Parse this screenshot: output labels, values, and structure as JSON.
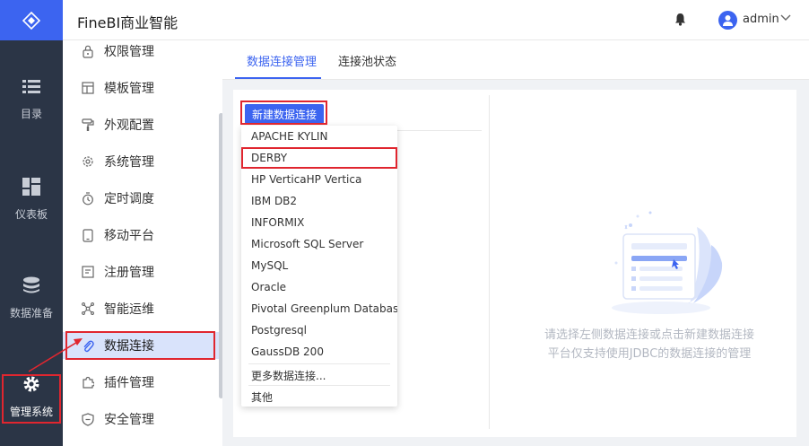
{
  "app": {
    "title": "FineBI商业智能"
  },
  "header": {
    "user": "admin"
  },
  "rail": {
    "items": [
      {
        "label": "目录",
        "icon": "list-icon"
      },
      {
        "label": "仪表板",
        "icon": "dashboard-icon"
      },
      {
        "label": "数据准备",
        "icon": "database-icon"
      },
      {
        "label": "管理系统",
        "icon": "gear-icon"
      }
    ]
  },
  "subnav": {
    "items": [
      {
        "label": "权限管理",
        "icon": "lock-icon"
      },
      {
        "label": "模板管理",
        "icon": "template-icon"
      },
      {
        "label": "外观配置",
        "icon": "paint-roller-icon"
      },
      {
        "label": "系统管理",
        "icon": "settings-icon"
      },
      {
        "label": "定时调度",
        "icon": "timer-icon"
      },
      {
        "label": "移动平台",
        "icon": "mobile-icon"
      },
      {
        "label": "注册管理",
        "icon": "register-icon"
      },
      {
        "label": "智能运维",
        "icon": "nodes-icon"
      },
      {
        "label": "数据连接",
        "icon": "paperclip-icon"
      },
      {
        "label": "插件管理",
        "icon": "puzzle-icon"
      },
      {
        "label": "安全管理",
        "icon": "shield-icon"
      }
    ],
    "active_index": 8
  },
  "tabs": [
    {
      "label": "数据连接管理"
    },
    {
      "label": "连接池状态"
    }
  ],
  "main": {
    "new_button": "新建数据连接",
    "empty_line1": "请选择左侧数据连接或点击新建数据连接",
    "empty_line2": "平台仅支持使用JDBC的数据连接的管理"
  },
  "dropdown": {
    "items": [
      "APACHE KYLIN",
      "DERBY",
      "HP VerticaHP Vertica",
      "IBM DB2",
      "INFORMIX",
      "Microsoft SQL Server",
      "MySQL",
      "Oracle",
      "Pivotal Greenplum Database",
      "Postgresql",
      "GaussDB 200"
    ],
    "more": "更多数据连接...",
    "other": "其他"
  },
  "colors": {
    "accent": "#3c64f0",
    "rail_bg": "#2b3546",
    "highlight": "#e0262f"
  }
}
